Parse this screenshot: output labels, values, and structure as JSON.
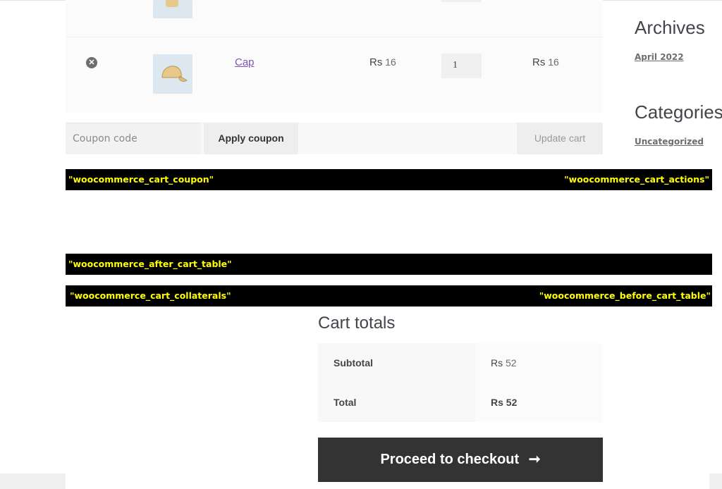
{
  "cart": {
    "rows": [
      {
        "name": "",
        "price": "",
        "qty": "",
        "subtotal": ""
      },
      {
        "name": "Cap",
        "currency": "Rs",
        "price": "16",
        "qty": "1",
        "subtotal": "16"
      }
    ],
    "remove_glyph": "✕"
  },
  "actions": {
    "coupon_placeholder": "Coupon code",
    "apply_label": "Apply coupon",
    "update_label": "Update cart"
  },
  "hooks": {
    "cart_coupon": "\"woocommerce_cart_coupon\"",
    "cart_actions": "\"woocommerce_cart_actions\"",
    "after_cart_table": "\"woocommerce_after_cart_table\"",
    "cart_collaterals": "\"woocommerce_cart_collaterals\"",
    "before_cart_table": "\"woocommerce_before_cart_table\""
  },
  "sidebar": {
    "archives_title": "Archives",
    "archives_link": "April 2022",
    "categories_title": "Categories",
    "categories_link": "Uncategorized"
  },
  "totals": {
    "title": "Cart totals",
    "subtotal_label": "Subtotal",
    "subtotal_currency": "Rs",
    "subtotal_value": "52",
    "total_label": "Total",
    "total_currency": "Rs",
    "total_value": "52",
    "checkout_label": "Proceed to checkout",
    "checkout_arrow": "➞"
  },
  "colors": {
    "link": "#7f54b3",
    "hook_text": "#ffff00",
    "hook_bg": "#000000",
    "checkout_bg": "#333333"
  }
}
